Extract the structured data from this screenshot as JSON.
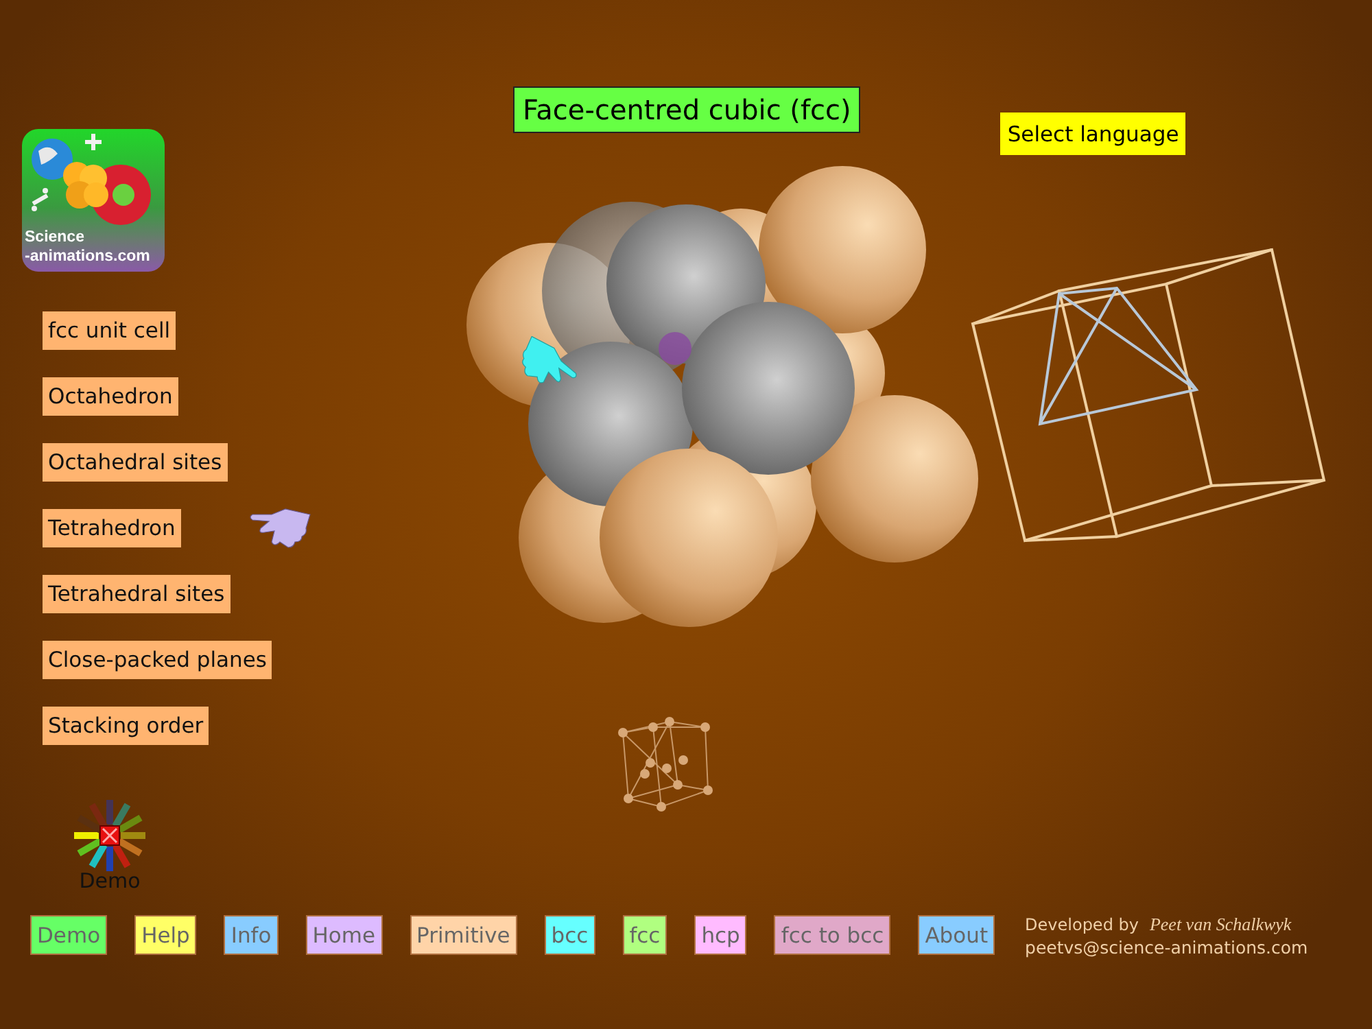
{
  "title": "Face-centred cubic (fcc)",
  "language_button": "Select language",
  "logo": {
    "lines": [
      "Science",
      "-animations.com"
    ]
  },
  "menu": [
    {
      "label": "fcc unit cell",
      "pointer": false
    },
    {
      "label": "Octahedron",
      "pointer": false
    },
    {
      "label": "Octahedral sites",
      "pointer": false
    },
    {
      "label": "Tetrahedron",
      "pointer": true
    },
    {
      "label": "Tetrahedral sites",
      "pointer": false
    },
    {
      "label": "Close-packed planes",
      "pointer": false
    },
    {
      "label": "Stacking order",
      "pointer": false
    }
  ],
  "demo_label": "Demo",
  "nav": [
    {
      "label": "Demo",
      "color": "#66ff66"
    },
    {
      "label": "Help",
      "color": "#ffff66"
    },
    {
      "label": "Info",
      "color": "#88ccff"
    },
    {
      "label": "Home",
      "color": "#ddbbff"
    },
    {
      "label": "Primitive",
      "color": "#ffd4a8"
    },
    {
      "label": "bcc",
      "color": "#66ffff"
    },
    {
      "label": "fcc",
      "color": "#b0ff80"
    },
    {
      "label": "hcp",
      "color": "#ffbbff"
    },
    {
      "label": "fcc to bcc",
      "color": "#e0a8c8"
    },
    {
      "label": "About",
      "color": "#88ccff"
    }
  ],
  "credits": {
    "prefix": "Developed by",
    "author": "Peet van Schalkwyk",
    "email": "peetvs@science-animations.com"
  }
}
